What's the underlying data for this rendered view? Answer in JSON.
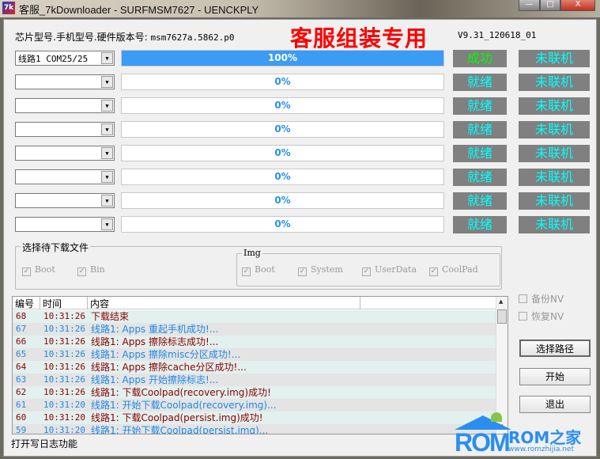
{
  "window": {
    "title": "客服_7kDownloader - SURFMSM7627 - UENCKPLY",
    "icon": "7k",
    "min": "—",
    "max": "□",
    "close": "X"
  },
  "info": {
    "label": "芯片型号.手机型号.硬件版本号:",
    "value": "msm7627a.5862.p0",
    "brand": "客服组装专用",
    "version": "V9.31_120618_01"
  },
  "lines": [
    {
      "port": "线路1  COM25/25",
      "progress": 100,
      "progress_label": "100%",
      "status": "成功",
      "status_color": "#00ff00",
      "conn": "未联机"
    },
    {
      "port": "",
      "progress": 0,
      "progress_label": "0%",
      "status": "就绪",
      "status_color": "#00ffff",
      "conn": "未联机"
    },
    {
      "port": "",
      "progress": 0,
      "progress_label": "0%",
      "status": "就绪",
      "status_color": "#00ffff",
      "conn": "未联机"
    },
    {
      "port": "",
      "progress": 0,
      "progress_label": "0%",
      "status": "就绪",
      "status_color": "#00ffff",
      "conn": "未联机"
    },
    {
      "port": "",
      "progress": 0,
      "progress_label": "0%",
      "status": "就绪",
      "status_color": "#00ffff",
      "conn": "未联机"
    },
    {
      "port": "",
      "progress": 0,
      "progress_label": "0%",
      "status": "就绪",
      "status_color": "#00ffff",
      "conn": "未联机"
    },
    {
      "port": "",
      "progress": 0,
      "progress_label": "0%",
      "status": "就绪",
      "status_color": "#00ffff",
      "conn": "未联机"
    },
    {
      "port": "",
      "progress": 0,
      "progress_label": "0%",
      "status": "就绪",
      "status_color": "#00ffff",
      "conn": "未联机"
    }
  ],
  "files": {
    "title": "选择待下载文件",
    "boot": "Boot",
    "bin": "Bin",
    "img_title": "Img",
    "img": [
      "Boot",
      "System",
      "UserData",
      "CoolPad"
    ]
  },
  "log": {
    "headers": [
      "编号",
      "时间",
      "内容"
    ],
    "rows": [
      {
        "id": "68",
        "time": "10:31:26",
        "text": "下载结束",
        "color": "red"
      },
      {
        "id": "67",
        "time": "10:31:26",
        "text": "线路1: Apps 重起手机成功!...",
        "color": "blue"
      },
      {
        "id": "66",
        "time": "10:31:26",
        "text": "线路1: Apps 擦除标志成功!...",
        "color": "red"
      },
      {
        "id": "65",
        "time": "10:31:26",
        "text": "线路1: Apps 擦除misc分区成功!...",
        "color": "blue"
      },
      {
        "id": "64",
        "time": "10:31:26",
        "text": "线路1: Apps 擦除cache分区成功!...",
        "color": "red"
      },
      {
        "id": "63",
        "time": "10:31:26",
        "text": "线路1: Apps 开始擦除标志!...",
        "color": "blue"
      },
      {
        "id": "62",
        "time": "10:31:26",
        "text": "线路1: 下载Coolpad(recovery.img)成功!",
        "color": "red"
      },
      {
        "id": "61",
        "time": "10:31:20",
        "text": "线路1: 开始下载Coolpad(recovery.img)...",
        "color": "blue"
      },
      {
        "id": "60",
        "time": "10:31:20",
        "text": "线路1: 下载Coolpad(persist.img)成功!",
        "color": "red"
      },
      {
        "id": "59",
        "time": "10:31:20",
        "text": "线路1: 开始下载Coolpad(persist.img)...",
        "color": "blue"
      }
    ]
  },
  "options": {
    "backup_nv": "备份NV",
    "restore_nv": "恢复NV"
  },
  "buttons": {
    "choose_path": "选择路径",
    "start": "开始",
    "exit": "退出"
  },
  "status": "打开写日志功能",
  "watermark": {
    "logo": "ROM",
    "name": "ROM之家",
    "url": "www.romzhijia.net"
  }
}
